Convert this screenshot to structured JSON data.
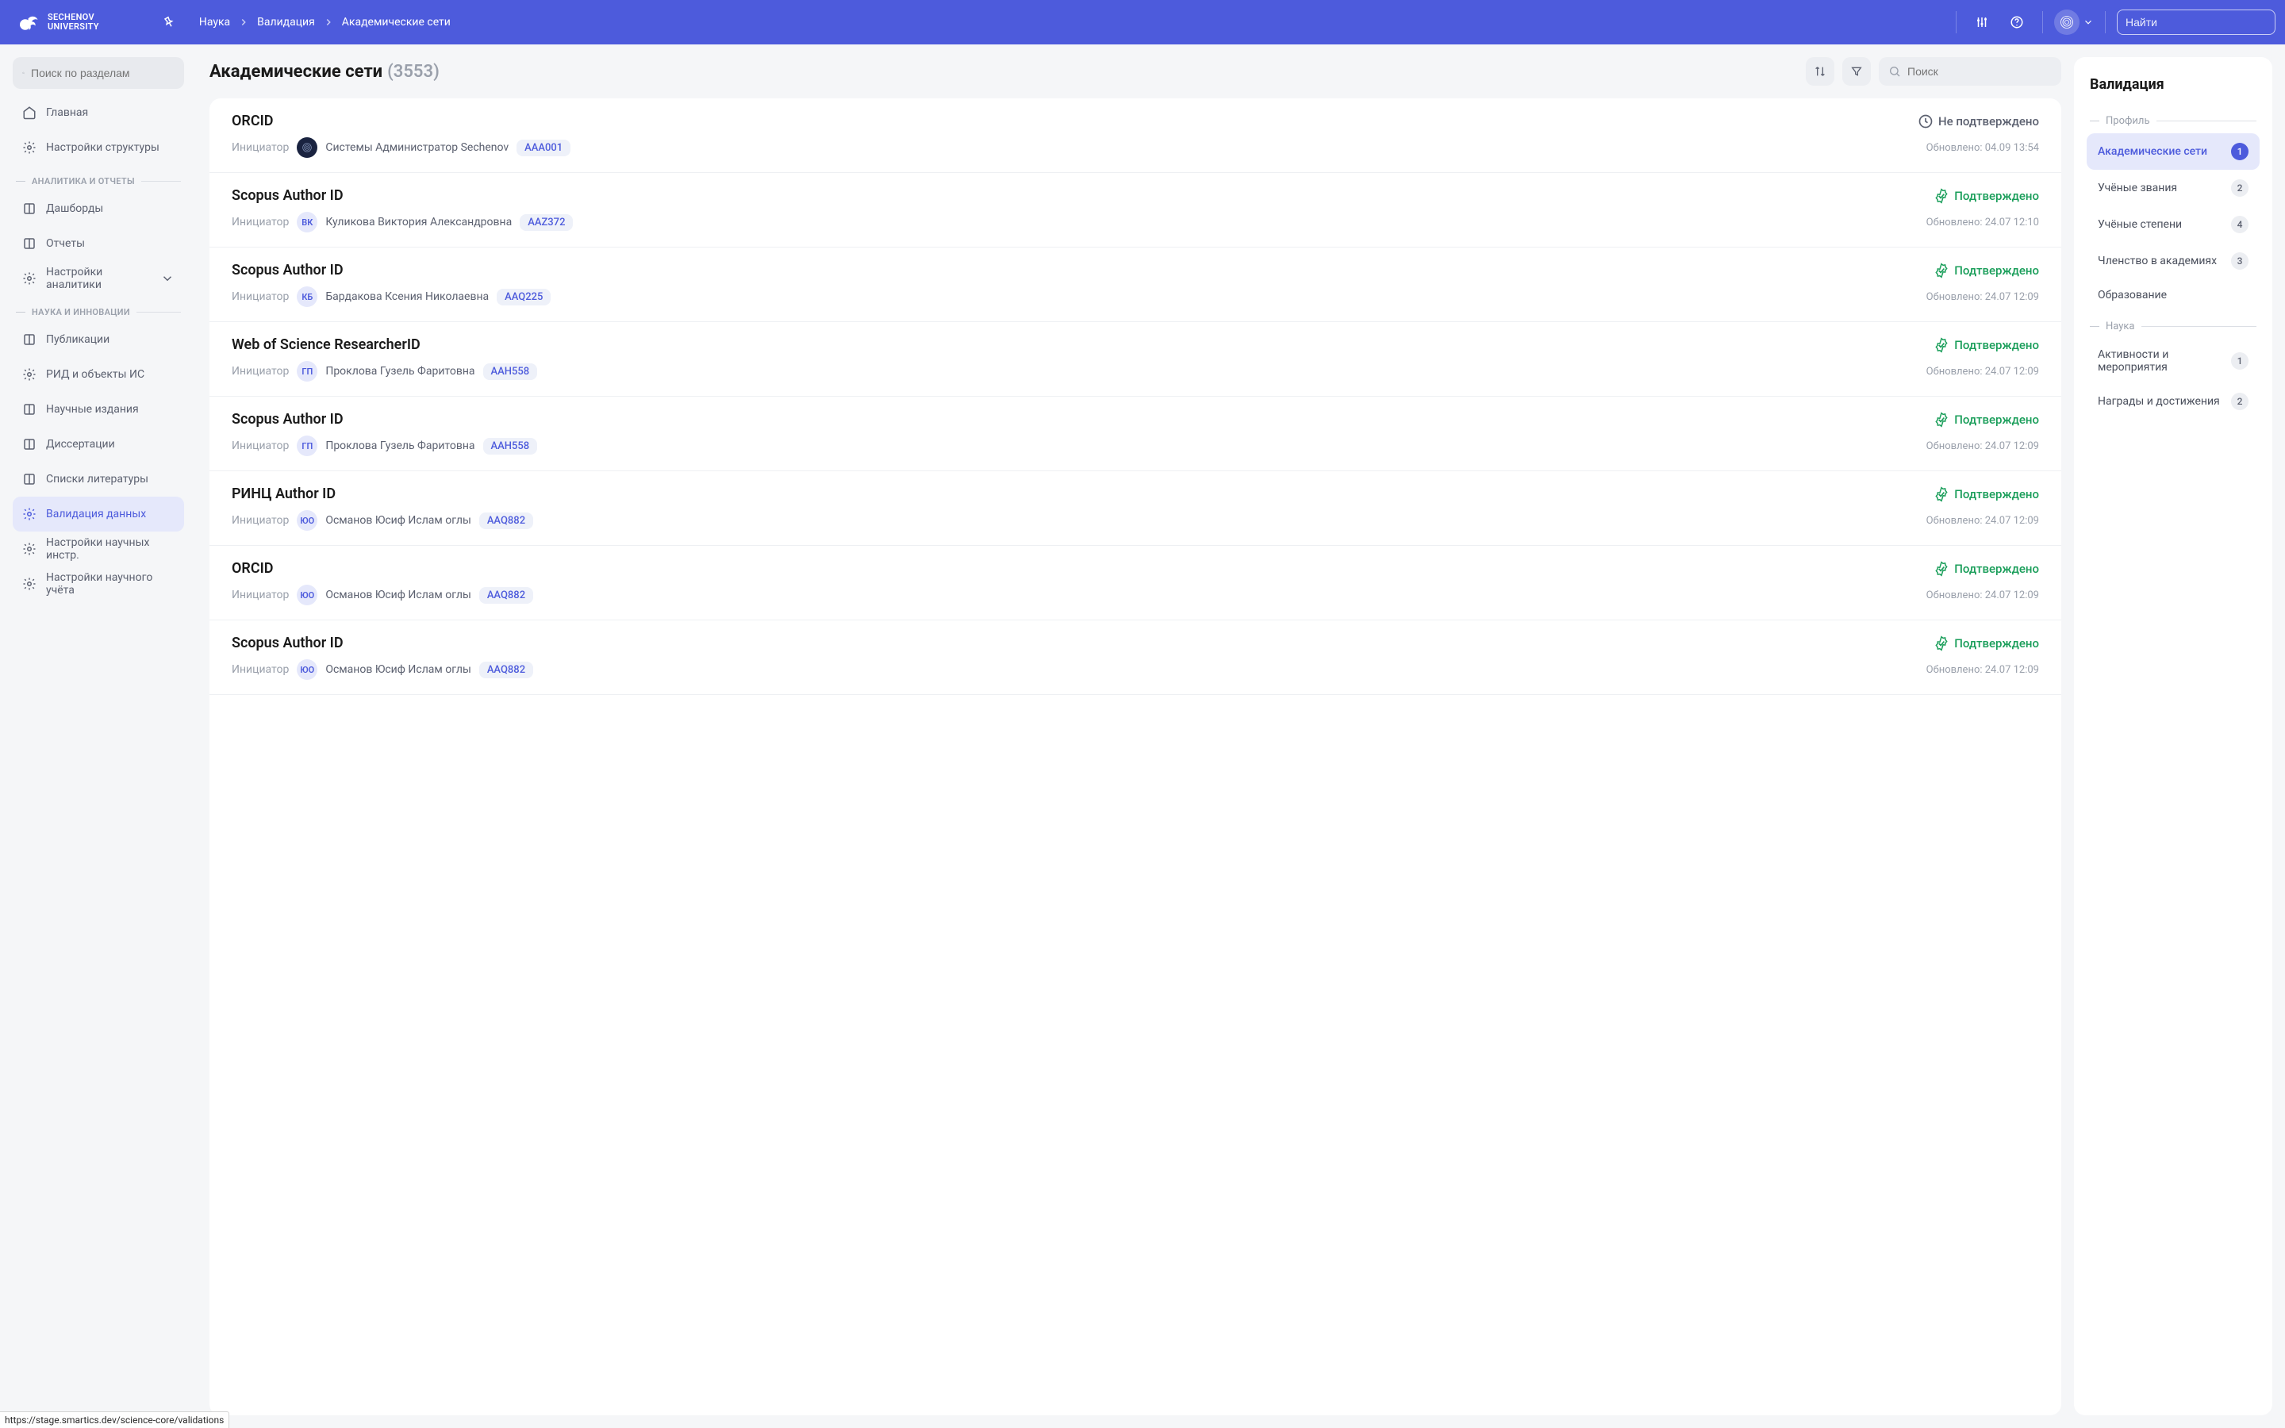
{
  "header": {
    "logo_top": "SECHENOV",
    "logo_bottom": "UNIVERSITY",
    "breadcrumbs": [
      "Наука",
      "Валидация",
      "Академические сети"
    ],
    "search_placeholder": "Найти"
  },
  "sidebar": {
    "search_placeholder": "Поиск по разделам",
    "items_top": [
      {
        "label": "Главная",
        "icon": "home"
      },
      {
        "label": "Настройки структуры",
        "icon": "gear"
      }
    ],
    "section_analytics": "АНАЛИТИКА И ОТЧЕТЫ",
    "items_analytics": [
      {
        "label": "Дашборды",
        "icon": "dashboard"
      },
      {
        "label": "Отчеты",
        "icon": "book"
      },
      {
        "label": "Настройки аналитики",
        "icon": "gear",
        "expandable": true
      }
    ],
    "section_science": "НАУКА И ИННОВАЦИИ",
    "items_science": [
      {
        "label": "Публикации",
        "icon": "doc"
      },
      {
        "label": "РИД и объекты ИС",
        "icon": "award"
      },
      {
        "label": "Научные издания",
        "icon": "library"
      },
      {
        "label": "Диссертации",
        "icon": "grad"
      },
      {
        "label": "Списки литературы",
        "icon": "list"
      },
      {
        "label": "Валидация данных",
        "icon": "gear",
        "active": true
      },
      {
        "label": "Настройки научных инстр.",
        "icon": "gear"
      },
      {
        "label": "Настройки научного учёта",
        "icon": "gear"
      }
    ]
  },
  "page": {
    "title": "Академические сети",
    "count": "(3553)",
    "search_placeholder": "Поиск"
  },
  "list": [
    {
      "title": "ORCID",
      "status": "pending",
      "status_label": "Не подтверждено",
      "initiator_label": "Инициатор",
      "avatar": "img",
      "initials": "",
      "name": "Системы Администратор Sechenov",
      "code": "AAA001",
      "updated": "Обновлено: 04.09 13:54"
    },
    {
      "title": "Scopus Author ID",
      "status": "ok",
      "status_label": "Подтверждено",
      "initiator_label": "Инициатор",
      "avatar": "blue",
      "initials": "ВК",
      "name": "Куликова Виктория Александровна",
      "code": "AAZ372",
      "updated": "Обновлено: 24.07 12:10"
    },
    {
      "title": "Scopus Author ID",
      "status": "ok",
      "status_label": "Подтверждено",
      "initiator_label": "Инициатор",
      "avatar": "blue",
      "initials": "КБ",
      "name": "Бардакова Ксения Николаевна",
      "code": "AAQ225",
      "updated": "Обновлено: 24.07 12:09"
    },
    {
      "title": "Web of Science ResearcherID",
      "status": "ok",
      "status_label": "Подтверждено",
      "initiator_label": "Инициатор",
      "avatar": "blue",
      "initials": "ГП",
      "name": "Проклова Гузель Фаритовна",
      "code": "AAH558",
      "updated": "Обновлено: 24.07 12:09"
    },
    {
      "title": "Scopus Author ID",
      "status": "ok",
      "status_label": "Подтверждено",
      "initiator_label": "Инициатор",
      "avatar": "blue",
      "initials": "ГП",
      "name": "Проклова Гузель Фаритовна",
      "code": "AAH558",
      "updated": "Обновлено: 24.07 12:09"
    },
    {
      "title": "РИНЦ Author ID",
      "status": "ok",
      "status_label": "Подтверждено",
      "initiator_label": "Инициатор",
      "avatar": "blue",
      "initials": "ЮО",
      "name": "Османов Юсиф Ислам оглы",
      "code": "AAQ882",
      "updated": "Обновлено: 24.07 12:09"
    },
    {
      "title": "ORCID",
      "status": "ok",
      "status_label": "Подтверждено",
      "initiator_label": "Инициатор",
      "avatar": "blue",
      "initials": "ЮО",
      "name": "Османов Юсиф Ислам оглы",
      "code": "AAQ882",
      "updated": "Обновлено: 24.07 12:09"
    },
    {
      "title": "Scopus Author ID",
      "status": "ok",
      "status_label": "Подтверждено",
      "initiator_label": "Инициатор",
      "avatar": "blue",
      "initials": "ЮО",
      "name": "Османов Юсиф Ислам оглы",
      "code": "AAQ882",
      "updated": "Обновлено: 24.07 12:09"
    }
  ],
  "rightpanel": {
    "title": "Валидация",
    "section_profile": "Профиль",
    "items_profile": [
      {
        "label": "Академические сети",
        "count": "1",
        "active": true
      },
      {
        "label": "Учёные звания",
        "count": "2"
      },
      {
        "label": "Учёные степени",
        "count": "4"
      },
      {
        "label": "Членство в академиях",
        "count": "3"
      },
      {
        "label": "Образование",
        "count": ""
      }
    ],
    "section_science": "Наука",
    "items_science": [
      {
        "label": "Активности и мероприятия",
        "count": "1"
      },
      {
        "label": "Награды и достижения",
        "count": "2"
      }
    ]
  },
  "url_tooltip": "https://stage.smartics.dev/science-core/validations"
}
